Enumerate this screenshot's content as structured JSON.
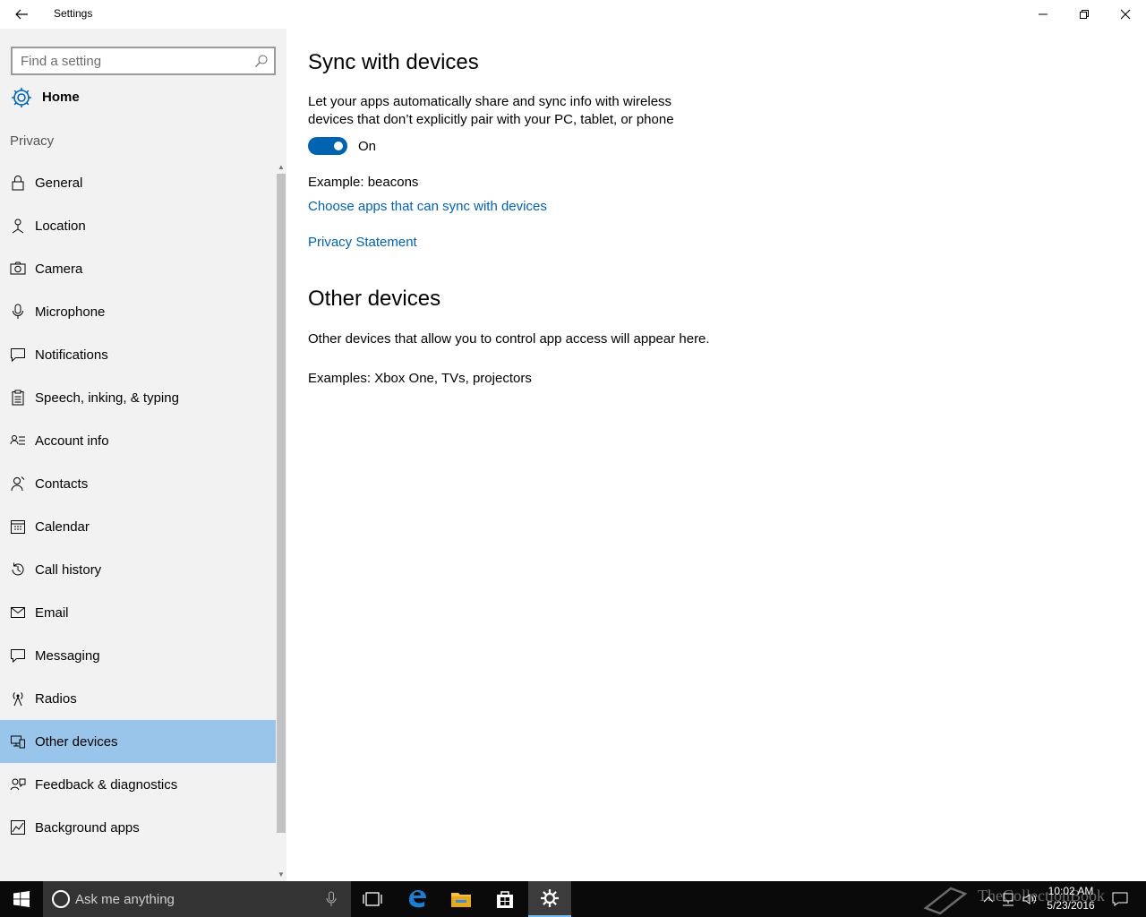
{
  "window": {
    "title": "Settings"
  },
  "sidebar": {
    "search_placeholder": "Find a setting",
    "home_label": "Home",
    "section_label": "Privacy",
    "items": [
      {
        "label": "General",
        "icon": "lock-icon"
      },
      {
        "label": "Location",
        "icon": "location-icon"
      },
      {
        "label": "Camera",
        "icon": "camera-icon"
      },
      {
        "label": "Microphone",
        "icon": "microphone-icon"
      },
      {
        "label": "Notifications",
        "icon": "notifications-icon"
      },
      {
        "label": "Speech, inking, & typing",
        "icon": "clipboard-icon"
      },
      {
        "label": "Account info",
        "icon": "account-info-icon"
      },
      {
        "label": "Contacts",
        "icon": "contacts-icon"
      },
      {
        "label": "Calendar",
        "icon": "calendar-icon"
      },
      {
        "label": "Call history",
        "icon": "history-icon"
      },
      {
        "label": "Email",
        "icon": "email-icon"
      },
      {
        "label": "Messaging",
        "icon": "messaging-icon"
      },
      {
        "label": "Radios",
        "icon": "radio-tower-icon"
      },
      {
        "label": "Other devices",
        "icon": "devices-icon",
        "selected": true
      },
      {
        "label": "Feedback & diagnostics",
        "icon": "feedback-icon"
      },
      {
        "label": "Background apps",
        "icon": "background-apps-icon"
      }
    ]
  },
  "content": {
    "sync": {
      "heading": "Sync with devices",
      "description": "Let your apps automatically share and sync info with wireless devices that don’t explicitly pair with your PC, tablet, or phone",
      "toggle_state": "On",
      "example": "Example: beacons",
      "choose_link": "Choose apps that can sync with devices",
      "privacy_link": "Privacy Statement"
    },
    "other": {
      "heading": "Other devices",
      "description": "Other devices that allow you to control app access will appear here.",
      "examples": "Examples: Xbox One, TVs, projectors"
    }
  },
  "taskbar": {
    "search_placeholder": "Ask me anything",
    "time": "10:02 AM",
    "date": "5/23/2016",
    "watermark": "TheCollectionBook"
  },
  "colors": {
    "accent": "#0063b1",
    "selected_bg": "#99c5ea",
    "sidebar_bg": "#f2f2f2",
    "taskbar_bg": "#0a0a0a"
  }
}
